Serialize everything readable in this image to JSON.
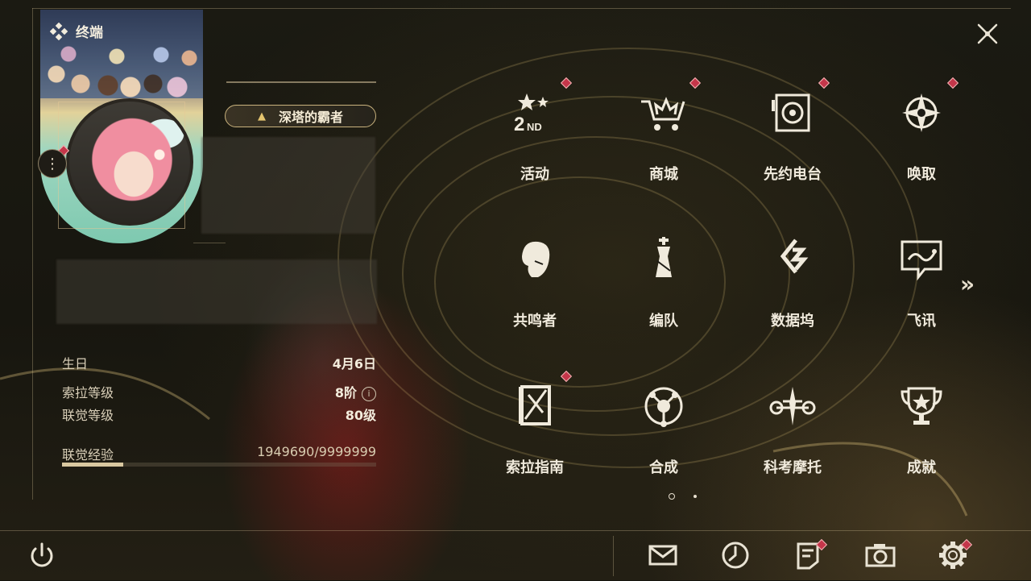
{
  "terminal": {
    "title": "终端"
  },
  "profile": {
    "title_badge": "深塔的霸者",
    "info": [
      {
        "label": "生日",
        "value": "4月6日"
      },
      {
        "label": "索拉等级",
        "value": "8阶"
      },
      {
        "label": "联觉等级",
        "value": "80级"
      }
    ],
    "exp": {
      "label": "联觉经验",
      "value": "1949690/9999999",
      "progress": 0.195
    }
  },
  "menu": {
    "items": [
      {
        "label": "活动",
        "icon": "event-2nd-anniversary-icon",
        "badge": true
      },
      {
        "label": "商城",
        "icon": "shop-cart-crown-icon",
        "badge": true
      },
      {
        "label": "先约电台",
        "icon": "radio-icon",
        "badge": true
      },
      {
        "label": "唤取",
        "icon": "convene-star-icon",
        "badge": true
      },
      {
        "label": "共鸣者",
        "icon": "resonator-portrait-icon",
        "badge": false
      },
      {
        "label": "编队",
        "icon": "team-chess-icon",
        "badge": false
      },
      {
        "label": "数据坞",
        "icon": "data-bank-icon",
        "badge": false
      },
      {
        "label": "飞讯",
        "icon": "message-chat-icon",
        "badge": false
      },
      {
        "label": "索拉指南",
        "icon": "guidebook-icon",
        "badge": true
      },
      {
        "label": "合成",
        "icon": "synthesis-icon",
        "badge": false
      },
      {
        "label": "科考摩托",
        "icon": "motorbike-icon",
        "badge": false
      },
      {
        "label": "成就",
        "icon": "trophy-icon",
        "badge": false
      }
    ],
    "next_page": "»",
    "page_count": 2,
    "current_page": 1
  },
  "bottom_bar": {
    "left": [
      {
        "icon": "power-icon"
      }
    ],
    "right": [
      {
        "icon": "mail-icon",
        "badge": false
      },
      {
        "icon": "clock-icon",
        "badge": false
      },
      {
        "icon": "notice-icon",
        "badge": true
      },
      {
        "icon": "camera-icon",
        "badge": false
      },
      {
        "icon": "settings-gear-icon",
        "badge": true
      }
    ]
  },
  "colors": {
    "accent_gold": "#c9b27d",
    "badge_red": "#c4364a",
    "text": "#ece6d8"
  }
}
